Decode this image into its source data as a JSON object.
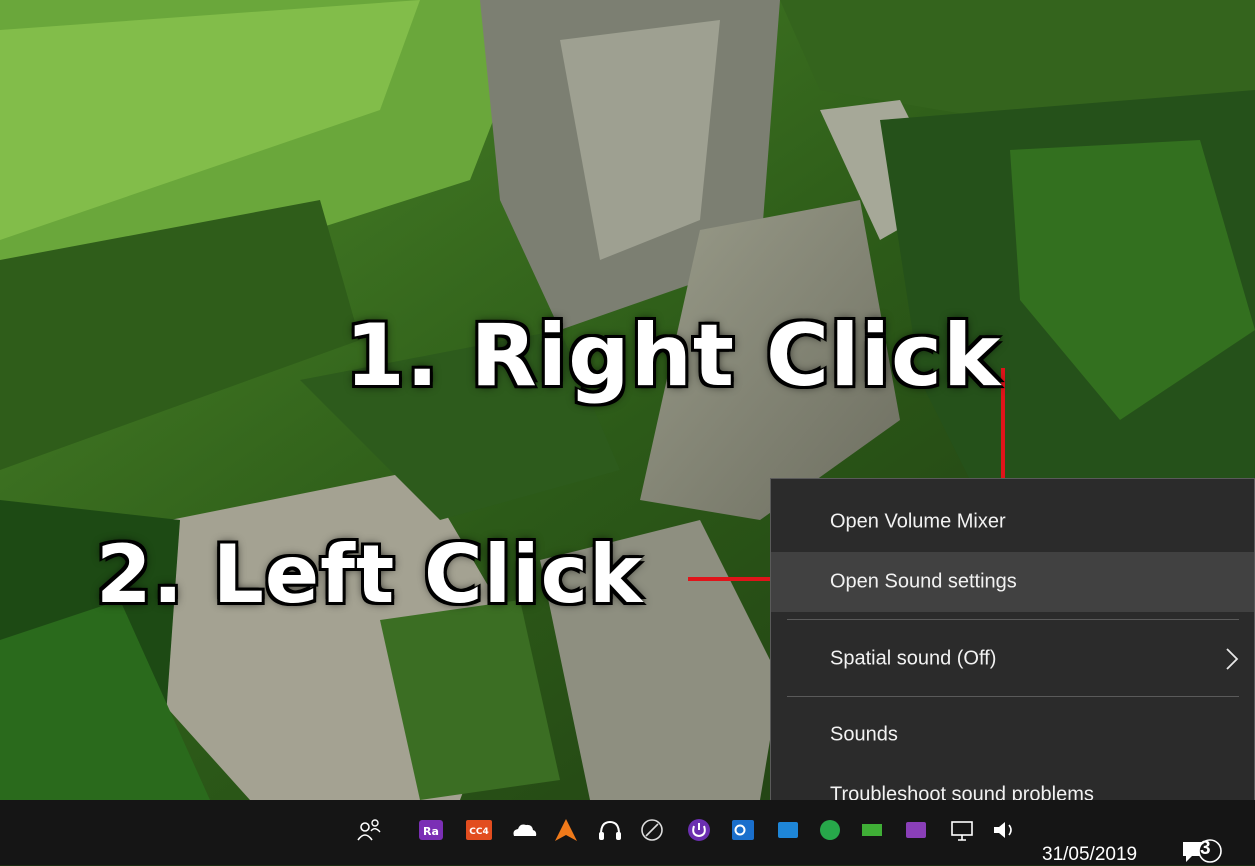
{
  "annotations": {
    "step1": "1. Right Click",
    "step2": "2. Left Click",
    "arrow_color": "#e0141a"
  },
  "context_menu": {
    "items": [
      {
        "label": "Open Volume Mixer",
        "highlighted": false
      },
      {
        "label": "Open Sound settings",
        "highlighted": true
      },
      {
        "label": "Spatial sound (Off)",
        "has_submenu": true
      },
      {
        "label": "Sounds"
      },
      {
        "label": "Troubleshoot sound problems"
      }
    ]
  },
  "taskbar": {
    "date": "31/05/2019",
    "notification_count": "3",
    "icons": [
      "people-icon",
      "rr-app-icon",
      "cc4-app-icon",
      "onedrive-icon",
      "avast-icon",
      "headphones-icon",
      "satellite-icon",
      "power-app-icon",
      "outlook-icon",
      "tray-icon-blue",
      "tray-icon-green",
      "tray-icon-green2",
      "tray-icon-purple",
      "network-icon",
      "volume-icon",
      "action-center-icon"
    ]
  },
  "colors": {
    "menu_bg": "#2b2b2b",
    "menu_hover": "#414141",
    "taskbar_bg": "#151515",
    "accent_red": "#e0141a"
  }
}
